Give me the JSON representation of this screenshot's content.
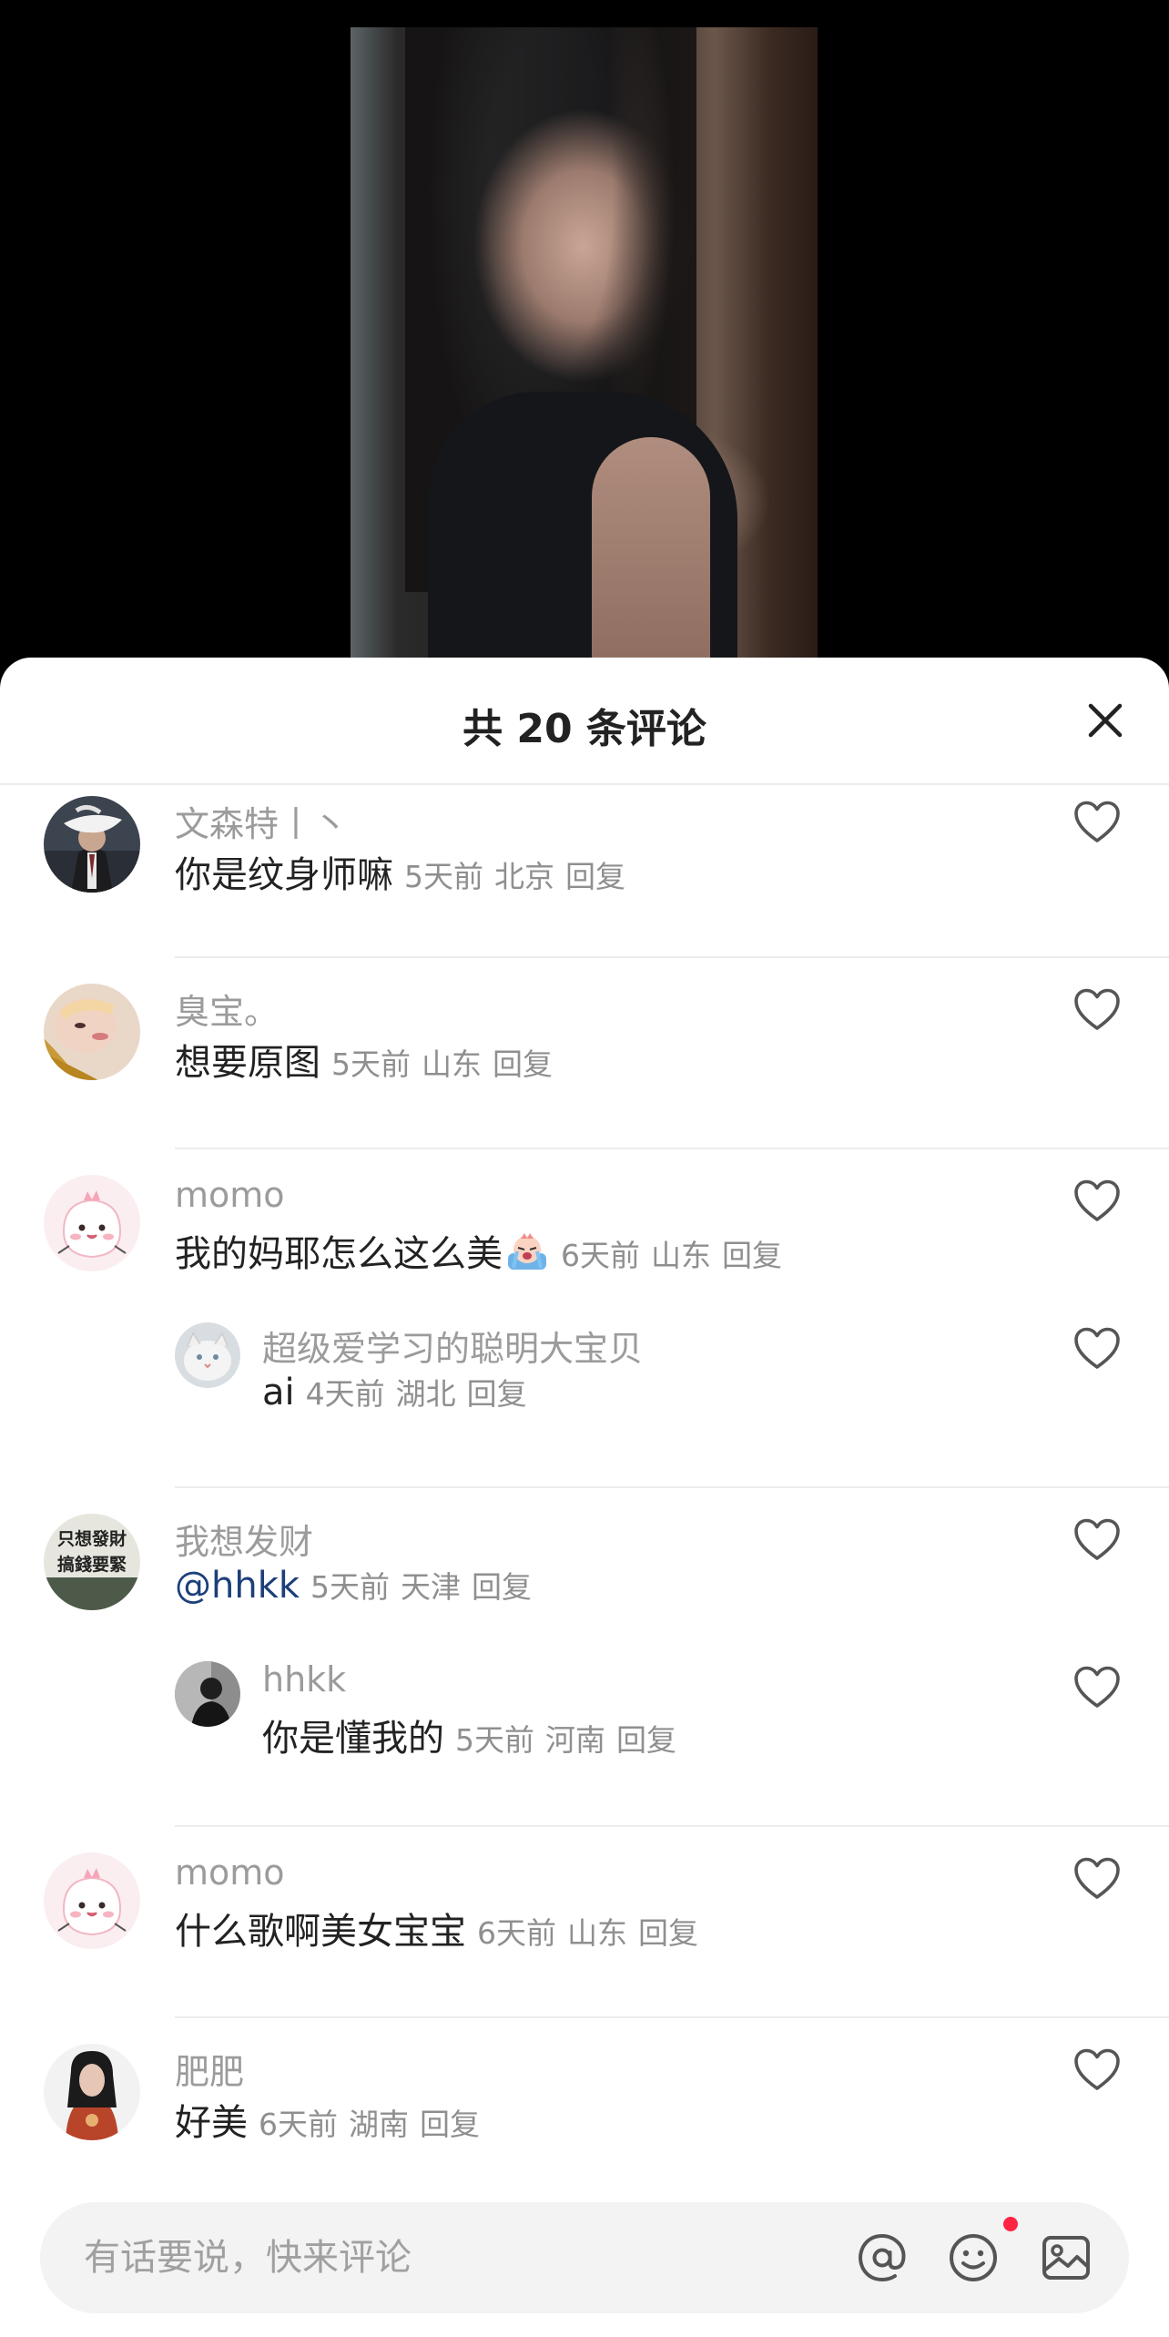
{
  "sheet": {
    "title": "共 20 条评论",
    "close_icon": "close-icon"
  },
  "comments": [
    {
      "name": "文森特丨丶",
      "text": "你是纹身师嘛",
      "time": "5天前",
      "location": "北京",
      "reply_label": "回复",
      "avatar": "avatar-bird-man"
    },
    {
      "name": "臭宝。",
      "text": "想要原图",
      "time": "5天前",
      "location": "山东",
      "reply_label": "回复",
      "avatar": "avatar-girl-face"
    },
    {
      "name": "momo",
      "text": "我的妈耶怎么这么美",
      "time": "6天前",
      "location": "山东",
      "reply_label": "回复",
      "avatar": "avatar-pink-dino",
      "emoji": "crying-emoji",
      "reply": {
        "name": "超级爱学习的聪明大宝贝",
        "text": "ai",
        "time": "4天前",
        "location": "湖北",
        "reply_label": "回复",
        "avatar": "avatar-white-cat"
      }
    },
    {
      "name": "我想发财",
      "text": "@hhkk",
      "time": "5天前",
      "location": "天津",
      "reply_label": "回复",
      "avatar": "avatar-text-sign",
      "avatar_text_1": "只想發財",
      "avatar_text_2": "搞錢要緊",
      "reply": {
        "name": "hhkk",
        "text": "你是懂我的",
        "time": "5天前",
        "location": "河南",
        "reply_label": "回复",
        "avatar": "avatar-dark-person"
      }
    },
    {
      "name": "momo",
      "text": "什么歌啊美女宝宝",
      "time": "6天前",
      "location": "山东",
      "reply_label": "回复",
      "avatar": "avatar-pink-dino"
    },
    {
      "name": "肥肥",
      "text": "好美",
      "time": "6天前",
      "location": "湖南",
      "reply_label": "回复",
      "avatar": "avatar-girl-red-shirt"
    }
  ],
  "bottom_bar": {
    "placeholder": "有话要说，快来评论",
    "icons": [
      "at-icon",
      "emoji-icon",
      "image-icon"
    ],
    "notification_dot_color": "#ff2442"
  },
  "colors": {
    "like_outline": "#555555",
    "mention": "#1d3f7a",
    "muted_text": "#9b9b9b"
  }
}
